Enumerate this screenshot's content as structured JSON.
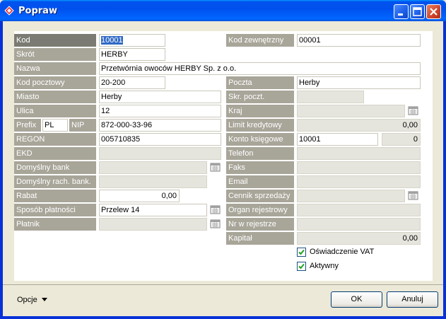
{
  "window": {
    "title": "Popraw"
  },
  "left": {
    "kod": {
      "label": "Kod",
      "value": "10001"
    },
    "skrot": {
      "label": "Skrót",
      "value": "HERBY"
    },
    "nazwa": {
      "label": "Nazwa",
      "value": "Przetwórnia owoców HERBY Sp. z o.o."
    },
    "kod_pocztowy": {
      "label": "Kod pocztowy",
      "value": "20-200"
    },
    "miasto": {
      "label": "Miasto",
      "value": "Herby"
    },
    "ulica": {
      "label": "Ulica",
      "value": "12"
    },
    "prefix": {
      "label": "Prefix",
      "value": "PL"
    },
    "nip": {
      "label": "NIP",
      "value": "872-000-33-96"
    },
    "regon": {
      "label": "REGON",
      "value": "005710835"
    },
    "ekd": {
      "label": "EKD",
      "value": ""
    },
    "domyslny_bank": {
      "label": "Domyślny bank",
      "value": ""
    },
    "domyslny_rach": {
      "label": "Domyślny rach. bank.",
      "value": ""
    },
    "rabat": {
      "label": "Rabat",
      "value": "0,00"
    },
    "sposob": {
      "label": "Sposób płatności",
      "value": "Przelew 14"
    },
    "platnik": {
      "label": "Płatnik",
      "value": ""
    }
  },
  "right": {
    "kod_zewn": {
      "label": "Kod zewnętrzny",
      "value": "00001"
    },
    "poczta": {
      "label": "Poczta",
      "value": "Herby"
    },
    "skr_poczt": {
      "label": "Skr. poczt.",
      "value": ""
    },
    "kraj": {
      "label": "Kraj",
      "value": ""
    },
    "limit": {
      "label": "Limit kredytowy",
      "value": "0,00"
    },
    "konto": {
      "label": "Konto księgowe",
      "value": "10001",
      "value2": "0"
    },
    "telefon": {
      "label": "Telefon",
      "value": ""
    },
    "faks": {
      "label": "Faks",
      "value": ""
    },
    "email": {
      "label": "Email",
      "value": ""
    },
    "cennik": {
      "label": "Cennik sprzedaży",
      "value": ""
    },
    "organ": {
      "label": "Organ rejestrowy",
      "value": ""
    },
    "nr_rej": {
      "label": "Nr w rejestrze",
      "value": ""
    },
    "kapital": {
      "label": "Kapitał",
      "value": "0,00"
    }
  },
  "checkboxes": {
    "vat": {
      "label": "Oświadczenie VAT",
      "checked": true
    },
    "aktywny": {
      "label": "Aktywny",
      "checked": true
    }
  },
  "footer": {
    "opcje": "Opcje",
    "ok": "OK",
    "anuluj": "Anuluj"
  },
  "icons": {
    "app": "diamond-icon",
    "minimize": "minimize-icon",
    "maximize": "maximize-icon",
    "close": "close-icon",
    "picker": "calendar-picker-icon",
    "dropdown": "dropdown-arrow-icon",
    "check": "checkmark-icon"
  },
  "colors": {
    "titlebar": "#0054e3",
    "label_bg": "#a8a599",
    "label_active": "#7b7b73",
    "disabled_field": "#e6e5dd",
    "close_button": "#d0432a"
  }
}
